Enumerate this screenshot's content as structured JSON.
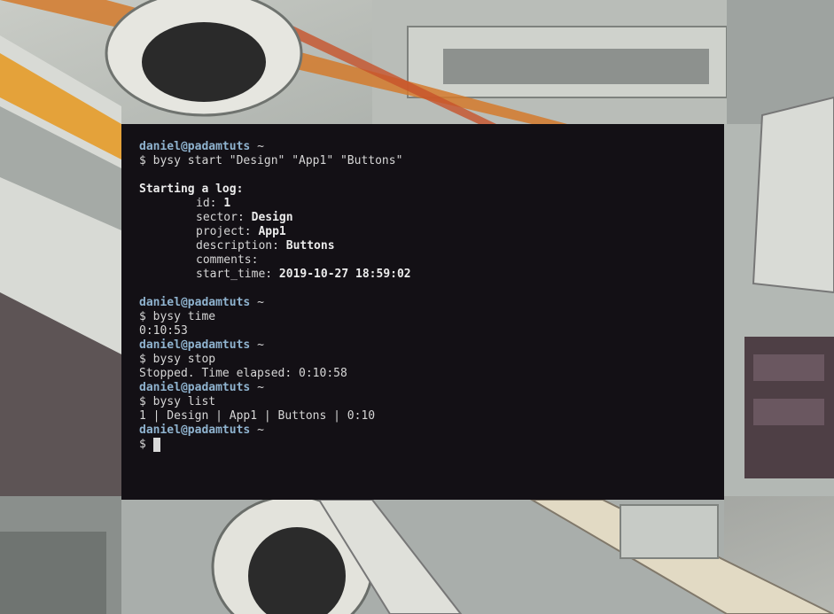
{
  "terminal": {
    "prompt_user": "daniel@padamtuts",
    "prompt_dir": "~",
    "ps1": "$",
    "cmd_start": "bysy start \"Design\" \"App1\" \"Buttons\"",
    "log_header": "Starting a log:",
    "fields": {
      "id_label": "id:",
      "id_value": "1",
      "sector_label": "sector:",
      "sector_value": "Design",
      "project_label": "project:",
      "project_value": "App1",
      "description_label": "description:",
      "description_value": "Buttons",
      "comments_label": "comments:",
      "start_time_label": "start_time:",
      "start_time_value": "2019-10-27 18:59:02"
    },
    "cmd_time": "bysy time",
    "out_time": "0:10:53",
    "cmd_stop": "bysy stop",
    "out_stop": "Stopped. Time elapsed: 0:10:58",
    "cmd_list": "bysy list",
    "out_list": "1 | Design | App1 | Buttons | 0:10"
  },
  "colors": {
    "terminal_bg": "#131015",
    "prompt_user": "#8fb3cf",
    "text": "#d6d6d6"
  }
}
